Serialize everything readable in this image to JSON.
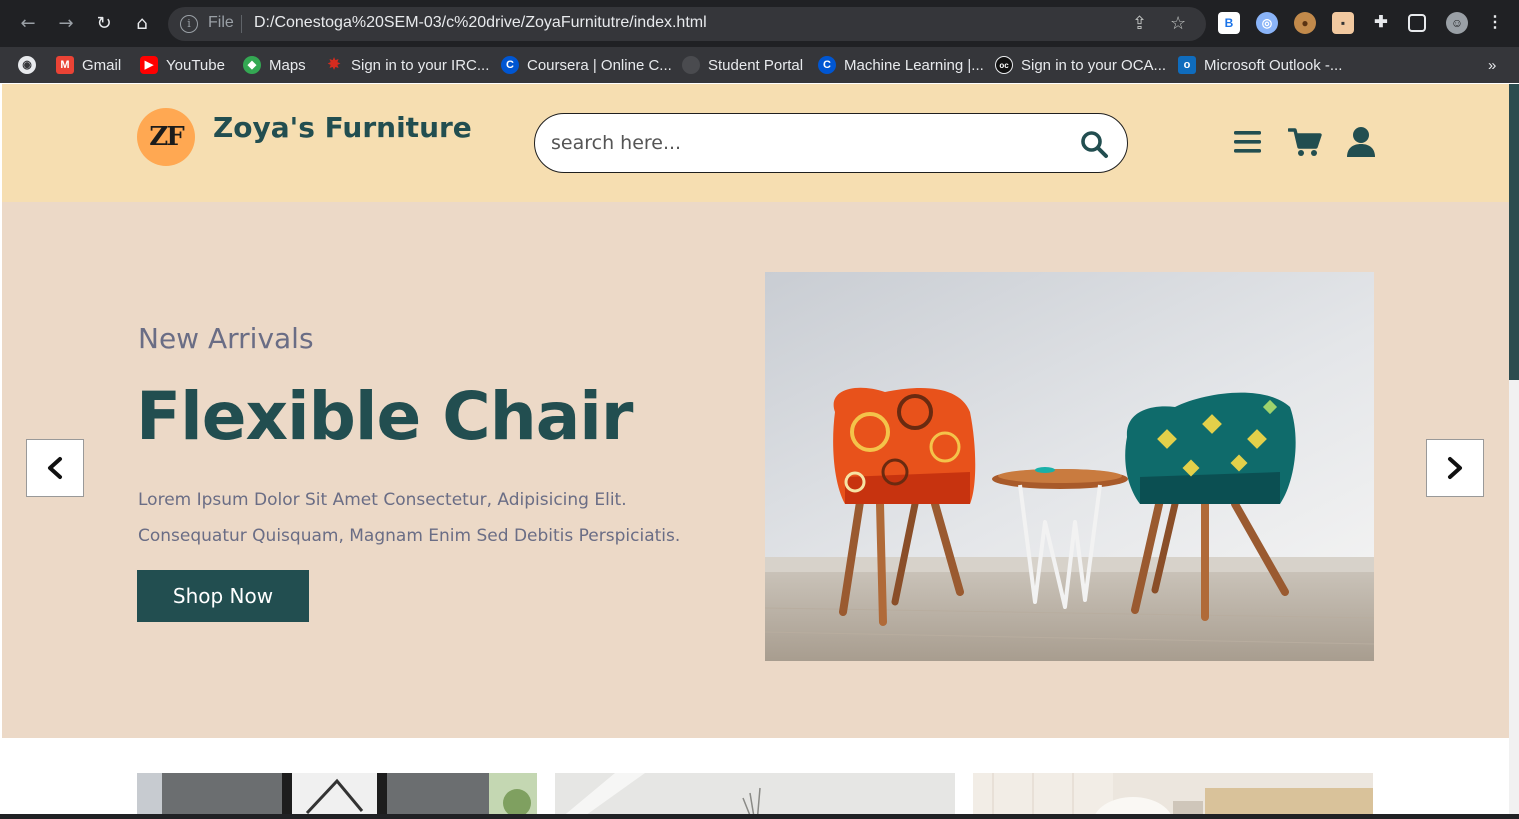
{
  "browser": {
    "url_scheme_label": "File",
    "url": "D:/Conestoga%20SEM-03/c%20drive/ZoyaFurnitutre/index.html",
    "extensions": [
      "B",
      "lens-icon",
      "cookie-icon",
      "profile-ext-icon",
      "puzzle-icon",
      "sidepanel-icon",
      "avatar"
    ],
    "bookmarks": [
      {
        "label": "Gmail",
        "icon": "gmail-icon"
      },
      {
        "label": "YouTube",
        "icon": "youtube-icon"
      },
      {
        "label": "Maps",
        "icon": "maps-icon"
      },
      {
        "label": "Sign in to your IRC...",
        "icon": "maple-leaf-icon"
      },
      {
        "label": "Coursera | Online C...",
        "icon": "coursera-icon"
      },
      {
        "label": "Student Portal",
        "icon": "globe-icon"
      },
      {
        "label": "Machine Learning |...",
        "icon": "coursera-icon"
      },
      {
        "label": "Sign in to your OCA...",
        "icon": "oca-icon"
      },
      {
        "label": "Microsoft Outlook -...",
        "icon": "outlook-icon"
      }
    ],
    "overflow_label": "»"
  },
  "header": {
    "logo_initials": "ZF",
    "brand": "Zoya's Furniture",
    "search_placeholder": "search here...",
    "icons": [
      "menu-icon",
      "cart-icon",
      "user-icon"
    ]
  },
  "hero": {
    "eyebrow": "New Arrivals",
    "title": "Flexible Chair",
    "description_line1": "Lorem Ipsum Dolor Sit Amet Consectetur, Adipisicing Elit.",
    "description_line2": "Consequatur Quisquam, Magnam Enim Sed Debitis Perspiciatis.",
    "cta_label": "Shop Now",
    "image_subject": "two-patterned-chairs-with-side-table"
  },
  "colors": {
    "header_bg": "#f6deb1",
    "hero_bg": "#ecd9c7",
    "brand_green": "#224e50",
    "text_muted": "#6a6d85",
    "logo_orange": "#ffa852"
  }
}
